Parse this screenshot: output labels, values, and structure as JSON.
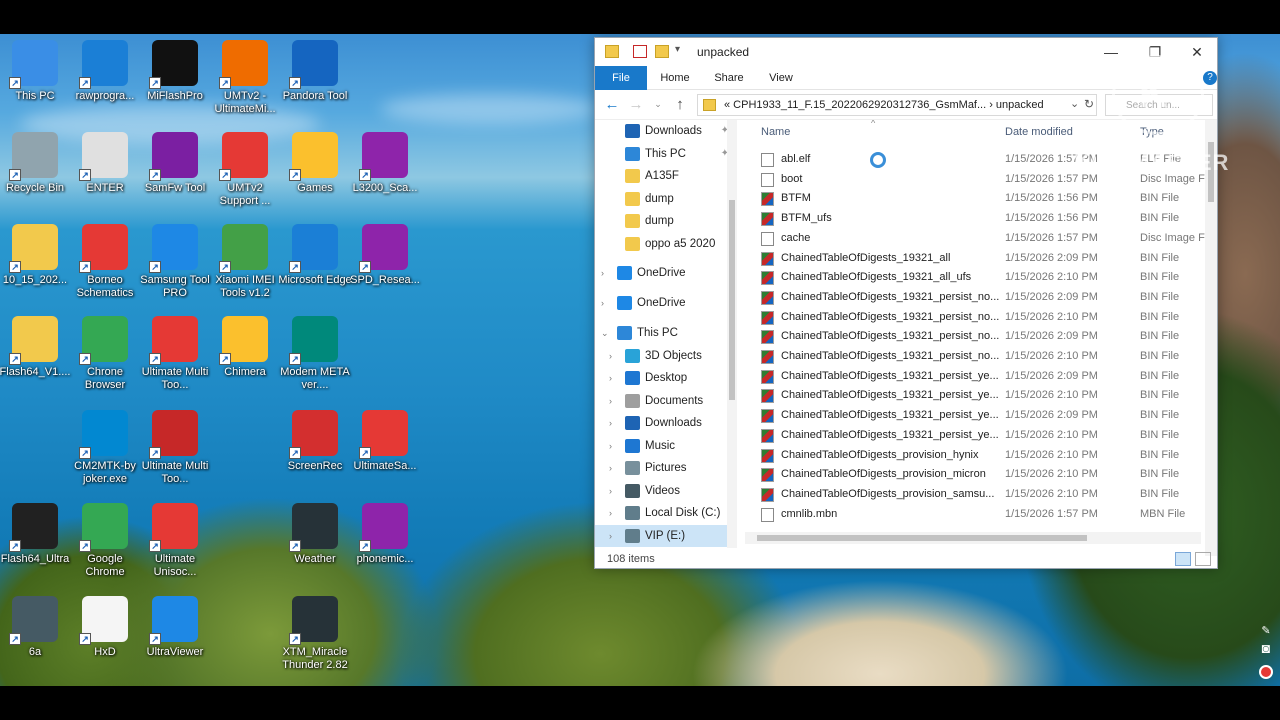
{
  "desktop": {
    "icons": [
      {
        "label": "This PC",
        "icon": "monitor-icon",
        "color": "#3a8ee6"
      },
      {
        "label": "rawprogra...",
        "icon": "edge-icon",
        "color": "#1b7fd6"
      },
      {
        "label": "MiFlashPro",
        "icon": "mi-logo-icon",
        "color": "#111111"
      },
      {
        "label": "UMTv2 - UltimateMi...",
        "icon": "umt-icon",
        "color": "#ef6c00"
      },
      {
        "label": "Pandora Tool",
        "icon": "pandora-icon",
        "color": "#1565c0"
      },
      {
        "label": "Recycle Bin",
        "icon": "recycle-bin-icon",
        "color": "#90a4ae"
      },
      {
        "label": "ENTER",
        "icon": "enter-doc-icon",
        "color": "#e0e0e0"
      },
      {
        "label": "SamFw Tool",
        "icon": "gear-icon",
        "color": "#7b1fa2"
      },
      {
        "label": "UMTv2 Support ...",
        "icon": "tools-icon",
        "color": "#e53935"
      },
      {
        "label": "Games",
        "icon": "gamepad-icon",
        "color": "#fbc02d"
      },
      {
        "label": "L3200_Sca...",
        "icon": "winrar-icon",
        "color": "#8e24aa"
      },
      {
        "label": "10_15_202...",
        "icon": "folder-icon",
        "color": "#f2c94c"
      },
      {
        "label": "Borneo Schematics",
        "icon": "borneo-icon",
        "color": "#e53935"
      },
      {
        "label": "Samsung Tool PRO",
        "icon": "samsung-tool-icon",
        "color": "#1e88e5"
      },
      {
        "label": "Xiaomi IMEI Tools v1.2",
        "icon": "xiaomi-imei-icon",
        "color": "#43a047"
      },
      {
        "label": "Microsoft Edge",
        "icon": "edge-icon",
        "color": "#1b7fd6"
      },
      {
        "label": "SPD_Resea...",
        "icon": "winrar-icon",
        "color": "#8e24aa"
      },
      {
        "label": "Flash64_V1....",
        "icon": "folder-icon",
        "color": "#f2c94c"
      },
      {
        "label": "Chrone Browser",
        "icon": "chrome-icon",
        "color": "#34a853"
      },
      {
        "label": "Ultimate Multi Too...",
        "icon": "umt-icon",
        "color": "#e53935"
      },
      {
        "label": "Chimera",
        "icon": "chimera-icon",
        "color": "#fbc02d"
      },
      {
        "label": "Modem META ver....",
        "icon": "modem-meta-icon",
        "color": "#00897b"
      },
      {
        "label": "CM2MTK-by joker.exe",
        "icon": "cm2-icon",
        "color": "#0288d1"
      },
      {
        "label": "Ultimate Multi Too...",
        "icon": "umt-icon",
        "color": "#c62828"
      },
      {
        "label": "ScreenRec",
        "icon": "record-icon",
        "color": "#d32f2f"
      },
      {
        "label": "UltimateSa...",
        "icon": "ultimate-sa-icon",
        "color": "#e53935"
      },
      {
        "label": "Flash64_Ultra",
        "icon": "flash64-icon",
        "color": "#212121"
      },
      {
        "label": "Google Chrome",
        "icon": "chrome-icon",
        "color": "#34a853"
      },
      {
        "label": "Ultimate Unisoc...",
        "icon": "umt-icon",
        "color": "#e53935"
      },
      {
        "label": "Weather",
        "icon": "weather-icon",
        "color": "#263238"
      },
      {
        "label": "phonemic...",
        "icon": "winrar-icon",
        "color": "#8e24aa"
      },
      {
        "label": "6a",
        "icon": "image-file-icon",
        "color": "#455a64"
      },
      {
        "label": "HxD",
        "icon": "hxd-icon",
        "color": "#f5f5f5"
      },
      {
        "label": "UltraViewer",
        "icon": "ultraviewer-icon",
        "color": "#1e88e5"
      },
      {
        "label": "XTM_Miracle Thunder 2.82",
        "icon": "miracle-icon",
        "color": "#263238"
      }
    ]
  },
  "explorer": {
    "title": "unpacked",
    "ribbon": {
      "tabs": [
        "File",
        "Home",
        "Share",
        "View"
      ]
    },
    "address": {
      "path": "«  CPH1933_11_F.15_2022062920312736_GsmMaf...  ›  unpacked"
    },
    "search": {
      "placeholder": "Search un..."
    },
    "nav": {
      "items": [
        {
          "label": "Downloads",
          "icon": "download-icon",
          "pinned": true
        },
        {
          "label": "This PC",
          "icon": "monitor-icon",
          "pinned": true
        },
        {
          "label": "A135F",
          "icon": "folder-icon"
        },
        {
          "label": "dump",
          "icon": "folder-icon"
        },
        {
          "label": "dump",
          "icon": "folder-icon"
        },
        {
          "label": "oppo a5 2020",
          "icon": "folder-icon"
        },
        {
          "label": "OneDrive",
          "icon": "cloud-icon"
        },
        {
          "label": "OneDrive",
          "icon": "cloud-icon"
        },
        {
          "label": "This PC",
          "icon": "monitor-icon"
        },
        {
          "label": "3D Objects",
          "icon": "cube-icon"
        },
        {
          "label": "Desktop",
          "icon": "desktop-icon"
        },
        {
          "label": "Documents",
          "icon": "document-icon"
        },
        {
          "label": "Downloads",
          "icon": "download-icon"
        },
        {
          "label": "Music",
          "icon": "music-icon"
        },
        {
          "label": "Pictures",
          "icon": "pictures-icon"
        },
        {
          "label": "Videos",
          "icon": "videos-icon"
        },
        {
          "label": "Local Disk (C:)",
          "icon": "drive-icon"
        },
        {
          "label": "VIP (E:)",
          "icon": "drive-icon"
        }
      ]
    },
    "columns": {
      "name": "Name",
      "date": "Date modified",
      "type": "Type"
    },
    "files": [
      {
        "name": "abl.elf",
        "date": "1/15/2026 1:57 PM",
        "type": "ELF File",
        "icon": "doc"
      },
      {
        "name": "boot",
        "date": "1/15/2026 1:57 PM",
        "type": "Disc Image F",
        "icon": "doc"
      },
      {
        "name": "BTFM",
        "date": "1/15/2026 1:56 PM",
        "type": "BIN File",
        "icon": "bin"
      },
      {
        "name": "BTFM_ufs",
        "date": "1/15/2026 1:56 PM",
        "type": "BIN File",
        "icon": "bin"
      },
      {
        "name": "cache",
        "date": "1/15/2026 1:57 PM",
        "type": "Disc Image F",
        "icon": "doc"
      },
      {
        "name": "ChainedTableOfDigests_19321_all",
        "date": "1/15/2026 2:09 PM",
        "type": "BIN File",
        "icon": "bin"
      },
      {
        "name": "ChainedTableOfDigests_19321_all_ufs",
        "date": "1/15/2026 2:10 PM",
        "type": "BIN File",
        "icon": "bin"
      },
      {
        "name": "ChainedTableOfDigests_19321_persist_no...",
        "date": "1/15/2026 2:09 PM",
        "type": "BIN File",
        "icon": "bin"
      },
      {
        "name": "ChainedTableOfDigests_19321_persist_no...",
        "date": "1/15/2026 2:10 PM",
        "type": "BIN File",
        "icon": "bin"
      },
      {
        "name": "ChainedTableOfDigests_19321_persist_no...",
        "date": "1/15/2026 2:09 PM",
        "type": "BIN File",
        "icon": "bin"
      },
      {
        "name": "ChainedTableOfDigests_19321_persist_no...",
        "date": "1/15/2026 2:10 PM",
        "type": "BIN File",
        "icon": "bin"
      },
      {
        "name": "ChainedTableOfDigests_19321_persist_ye...",
        "date": "1/15/2026 2:09 PM",
        "type": "BIN File",
        "icon": "bin"
      },
      {
        "name": "ChainedTableOfDigests_19321_persist_ye...",
        "date": "1/15/2026 2:10 PM",
        "type": "BIN File",
        "icon": "bin"
      },
      {
        "name": "ChainedTableOfDigests_19321_persist_ye...",
        "date": "1/15/2026 2:09 PM",
        "type": "BIN File",
        "icon": "bin"
      },
      {
        "name": "ChainedTableOfDigests_19321_persist_ye...",
        "date": "1/15/2026 2:10 PM",
        "type": "BIN File",
        "icon": "bin"
      },
      {
        "name": "ChainedTableOfDigests_provision_hynix",
        "date": "1/15/2026 2:10 PM",
        "type": "BIN File",
        "icon": "bin"
      },
      {
        "name": "ChainedTableOfDigests_provision_micron",
        "date": "1/15/2026 2:10 PM",
        "type": "BIN File",
        "icon": "bin"
      },
      {
        "name": "ChainedTableOfDigests_provision_samsu...",
        "date": "1/15/2026 2:10 PM",
        "type": "BIN File",
        "icon": "bin"
      },
      {
        "name": "cmnlib.mbn",
        "date": "1/15/2026 1:57 PM",
        "type": "MBN File",
        "icon": "doc"
      }
    ],
    "status": {
      "item_count": "108 items"
    }
  },
  "watermark": {
    "text": "KINEMASTER",
    "logo_letter": "K"
  },
  "colors": {
    "accent": "#1979ca",
    "selection": "#cce4f7",
    "header_text": "#4a5c78"
  }
}
